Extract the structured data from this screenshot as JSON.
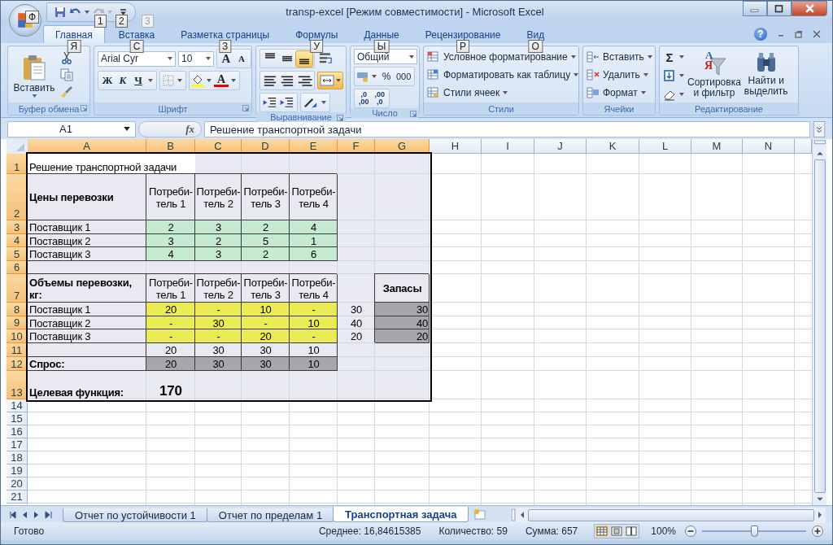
{
  "window": {
    "title": "transp-excel  [Режим совместимости] - Microsoft Excel"
  },
  "office_button": {
    "keytip": "Ф"
  },
  "quick_access": {
    "keytips": [
      {
        "label": "1",
        "disabled": false
      },
      {
        "label": "2",
        "disabled": false
      },
      {
        "label": "3",
        "disabled": true
      }
    ]
  },
  "ribbon": {
    "help": "?",
    "tabs": [
      {
        "label": "Главная",
        "keytip": "Я",
        "selected": true
      },
      {
        "label": "Вставка",
        "keytip": "С",
        "selected": false
      },
      {
        "label": "Разметка страницы",
        "keytip": "З",
        "selected": false
      },
      {
        "label": "Формулы",
        "keytip": "У",
        "selected": false
      },
      {
        "label": "Данные",
        "keytip": "Ы",
        "selected": false
      },
      {
        "label": "Рецензирование",
        "keytip": "Р",
        "selected": false
      },
      {
        "label": "Вид",
        "keytip": "О",
        "selected": false
      }
    ],
    "clipboard": {
      "title": "Буфер обмена",
      "paste": "Вставить"
    },
    "font": {
      "title": "Шрифт",
      "name": "Arial Cyr",
      "size": "10",
      "grow": "A",
      "shrink": "A",
      "styles": [
        "Ж",
        "К",
        "Ч"
      ],
      "color_glyph": "A"
    },
    "alignment": {
      "title": "Выравнивание",
      "vertical": [
        {
          "selected": false
        },
        {
          "selected": false
        },
        {
          "selected": true
        }
      ],
      "merge": {
        "selected": true
      }
    },
    "number": {
      "title": "Число",
      "format": "Общий",
      "percent": "%",
      "thousands": "000",
      "decimals": [
        [
          ",0",
          ",00"
        ],
        [
          ",00",
          ",0"
        ]
      ]
    },
    "styles": {
      "title": "Стили",
      "items": [
        "Условное форматирование",
        "Форматировать как таблицу",
        "Стили ячеек"
      ]
    },
    "cells": {
      "title": "Ячейки",
      "items": [
        "Вставить",
        "Удалить",
        "Формат"
      ]
    },
    "editing": {
      "title": "Редактирование",
      "sum": "Σ",
      "sort": "Сортировка\nи фильтр",
      "sort_glyphs": [
        "A",
        "Я"
      ],
      "find": "Найти и\nвыделить"
    }
  },
  "formula_bar": {
    "name_box": "A1",
    "fx": "fx",
    "formula": "Решение транспортной задачи"
  },
  "sheet": {
    "columns": [
      {
        "label": "A",
        "selected": true
      },
      {
        "label": "B",
        "selected": true
      },
      {
        "label": "C",
        "selected": true
      },
      {
        "label": "D",
        "selected": true
      },
      {
        "label": "E",
        "selected": true
      },
      {
        "label": "F",
        "selected": true
      },
      {
        "label": "G",
        "selected": true
      },
      {
        "label": "H",
        "selected": false
      },
      {
        "label": "I",
        "selected": false
      },
      {
        "label": "J",
        "selected": false
      },
      {
        "label": "K",
        "selected": false
      },
      {
        "label": "L",
        "selected": false
      },
      {
        "label": "M",
        "selected": false
      },
      {
        "label": "N",
        "selected": false
      }
    ],
    "rows": [
      {
        "number": "1",
        "selected": true,
        "cells": [
          {
            "kind": "current",
            "text": "Решение транспортной задачи"
          },
          {
            "kind": "plain"
          },
          {
            "kind": "plain"
          },
          {
            "kind": "plain"
          },
          {
            "kind": "plain"
          },
          {
            "kind": "plain"
          },
          {
            "kind": "plain"
          }
        ]
      },
      {
        "number": "2",
        "selected": true,
        "cells": [
          {
            "kind": "label",
            "text": "Цены перевозки"
          },
          {
            "kind": "boxed",
            "text": "Потреби-\nтель 1"
          },
          {
            "kind": "boxed",
            "text": "Потреби-\nтель 2"
          },
          {
            "kind": "boxed",
            "text": "Потреби-\nтель 3"
          },
          {
            "kind": "boxed",
            "text": "Потреби-\nтель 4"
          },
          {
            "kind": "plain"
          },
          {
            "kind": "plain"
          }
        ]
      },
      {
        "number": "3",
        "selected": true,
        "cells": [
          {
            "kind": "boxed",
            "text": "Поставщик 1"
          },
          {
            "kind": "green",
            "text": "2"
          },
          {
            "kind": "green",
            "text": "3"
          },
          {
            "kind": "green",
            "text": "2"
          },
          {
            "kind": "green",
            "text": "4"
          },
          {
            "kind": "plain"
          },
          {
            "kind": "plain"
          }
        ]
      },
      {
        "number": "4",
        "selected": true,
        "cells": [
          {
            "kind": "boxed",
            "text": "Поставщик 2"
          },
          {
            "kind": "green",
            "text": "3"
          },
          {
            "kind": "green",
            "text": "2"
          },
          {
            "kind": "green",
            "text": "5"
          },
          {
            "kind": "green",
            "text": "1"
          },
          {
            "kind": "plain"
          },
          {
            "kind": "plain"
          }
        ]
      },
      {
        "number": "5",
        "selected": true,
        "cells": [
          {
            "kind": "boxed",
            "text": "Поставщик 3"
          },
          {
            "kind": "green",
            "text": "4"
          },
          {
            "kind": "green",
            "text": "3"
          },
          {
            "kind": "green",
            "text": "2"
          },
          {
            "kind": "green",
            "text": "6"
          },
          {
            "kind": "plain"
          },
          {
            "kind": "plain"
          }
        ]
      },
      {
        "number": "6",
        "selected": true,
        "cells": [
          {
            "kind": "plain"
          },
          {
            "kind": "plain"
          },
          {
            "kind": "plain"
          },
          {
            "kind": "plain"
          },
          {
            "kind": "plain"
          },
          {
            "kind": "plain"
          },
          {
            "kind": "plain"
          }
        ]
      },
      {
        "number": "7",
        "selected": true,
        "cells": [
          {
            "kind": "label",
            "text": "Объемы перевозки, кг:"
          },
          {
            "kind": "boxed",
            "text": "Потреби-\nтель 1"
          },
          {
            "kind": "boxed",
            "text": "Потреби-\nтель 2"
          },
          {
            "kind": "boxed",
            "text": "Потреби-\nтель 3"
          },
          {
            "kind": "boxed",
            "text": "Потреби-\nтель 4"
          },
          {
            "kind": "plain"
          },
          {
            "kind": "label",
            "text": "Запасы"
          }
        ]
      },
      {
        "number": "8",
        "selected": true,
        "cells": [
          {
            "kind": "boxed",
            "text": "Поставщик 1"
          },
          {
            "kind": "yellow",
            "text": "20"
          },
          {
            "kind": "yellow",
            "text": "-"
          },
          {
            "kind": "yellow",
            "text": "10"
          },
          {
            "kind": "yellow",
            "text": "-"
          },
          {
            "kind": "plain",
            "text": "30"
          },
          {
            "kind": "gray",
            "text": "30"
          }
        ]
      },
      {
        "number": "9",
        "selected": true,
        "cells": [
          {
            "kind": "boxed",
            "text": "Поставщик 2"
          },
          {
            "kind": "yellow",
            "text": "-"
          },
          {
            "kind": "yellow",
            "text": "30"
          },
          {
            "kind": "yellow",
            "text": "-"
          },
          {
            "kind": "yellow",
            "text": "10"
          },
          {
            "kind": "plain",
            "text": "40"
          },
          {
            "kind": "gray",
            "text": "40"
          }
        ]
      },
      {
        "number": "10",
        "selected": true,
        "cells": [
          {
            "kind": "boxed",
            "text": "Поставщик 3"
          },
          {
            "kind": "yellow",
            "text": "-"
          },
          {
            "kind": "yellow",
            "text": "-"
          },
          {
            "kind": "yellow",
            "text": "20"
          },
          {
            "kind": "yellow",
            "text": "-"
          },
          {
            "kind": "plain",
            "text": "20"
          },
          {
            "kind": "gray",
            "text": "20"
          }
        ]
      },
      {
        "number": "11",
        "selected": true,
        "cells": [
          {
            "kind": "boxed"
          },
          {
            "kind": "boxed",
            "text": "20"
          },
          {
            "kind": "boxed",
            "text": "30"
          },
          {
            "kind": "boxed",
            "text": "30"
          },
          {
            "kind": "boxed",
            "text": "10"
          },
          {
            "kind": "plain"
          },
          {
            "kind": "plain"
          }
        ]
      },
      {
        "number": "12",
        "selected": true,
        "cells": [
          {
            "kind": "label",
            "text": "Спрос:"
          },
          {
            "kind": "gray",
            "text": "20"
          },
          {
            "kind": "gray",
            "text": "30"
          },
          {
            "kind": "gray",
            "text": "30"
          },
          {
            "kind": "gray",
            "text": "10"
          },
          {
            "kind": "plain"
          },
          {
            "kind": "plain"
          }
        ]
      },
      {
        "number": "13",
        "selected": true,
        "cells": [
          {
            "kind": "heading",
            "text": "Целевая функция:"
          },
          {
            "kind": "result",
            "text": "170"
          },
          {
            "kind": "plain"
          },
          {
            "kind": "plain"
          },
          {
            "kind": "plain"
          },
          {
            "kind": "plain"
          },
          {
            "kind": "plain"
          }
        ]
      },
      {
        "number": "14",
        "selected": false
      },
      {
        "number": "15",
        "selected": false
      },
      {
        "number": "16",
        "selected": false
      },
      {
        "number": "17",
        "selected": false
      },
      {
        "number": "18",
        "selected": false
      },
      {
        "number": "19",
        "selected": false
      },
      {
        "number": "20",
        "selected": false
      },
      {
        "number": "21",
        "selected": false
      }
    ]
  },
  "sheet_tabs": [
    {
      "label": "Отчет по устойчивости 1",
      "selected": false
    },
    {
      "label": "Отчет по пределам 1",
      "selected": false
    },
    {
      "label": "Транспортная задача",
      "selected": true
    }
  ],
  "status_bar": {
    "mode": "Готово",
    "stats": [
      "Среднее: 16,84615385",
      "Количество: 59",
      "Сумма: 657"
    ],
    "zoom": "100%",
    "zoom_slider": {
      "level": 0.5
    }
  }
}
